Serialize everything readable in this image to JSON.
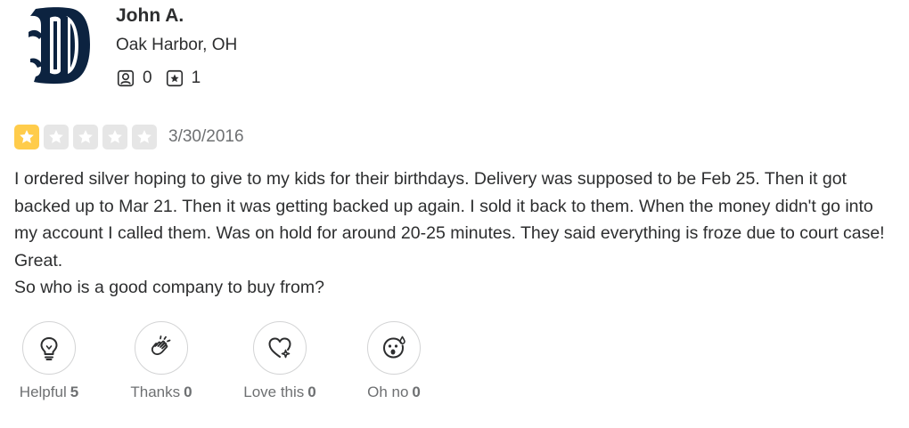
{
  "user": {
    "name": "John A.",
    "location": "Oak Harbor, OH",
    "friends_count": "0",
    "reviews_count": "1"
  },
  "review": {
    "rating": 1,
    "max_rating": 5,
    "date": "3/30/2016",
    "paragraphs": [
      "I ordered silver hoping to give to my kids for their birthdays. Delivery was supposed to be Feb 25. Then it got backed up to Mar 21. Then it was getting backed up again. I sold it back to them. When the money didn't go into my account I called them. Was on hold for around 20-25 minutes. They said everything is froze due to court case! Great.",
      "So who is a good company to buy from?"
    ]
  },
  "reactions": [
    {
      "label": "Helpful",
      "count": "5",
      "icon": "lightbulb-icon"
    },
    {
      "label": "Thanks",
      "count": "0",
      "icon": "clapping-hands-icon"
    },
    {
      "label": "Love this",
      "count": "0",
      "icon": "heart-icon"
    },
    {
      "label": "Oh no",
      "count": "0",
      "icon": "surprised-face-icon"
    }
  ],
  "colors": {
    "star_filled": "#ffcc4b",
    "star_empty": "#e6e6e6",
    "avatar_navy": "#0c2340",
    "muted_text": "#6e7072"
  }
}
